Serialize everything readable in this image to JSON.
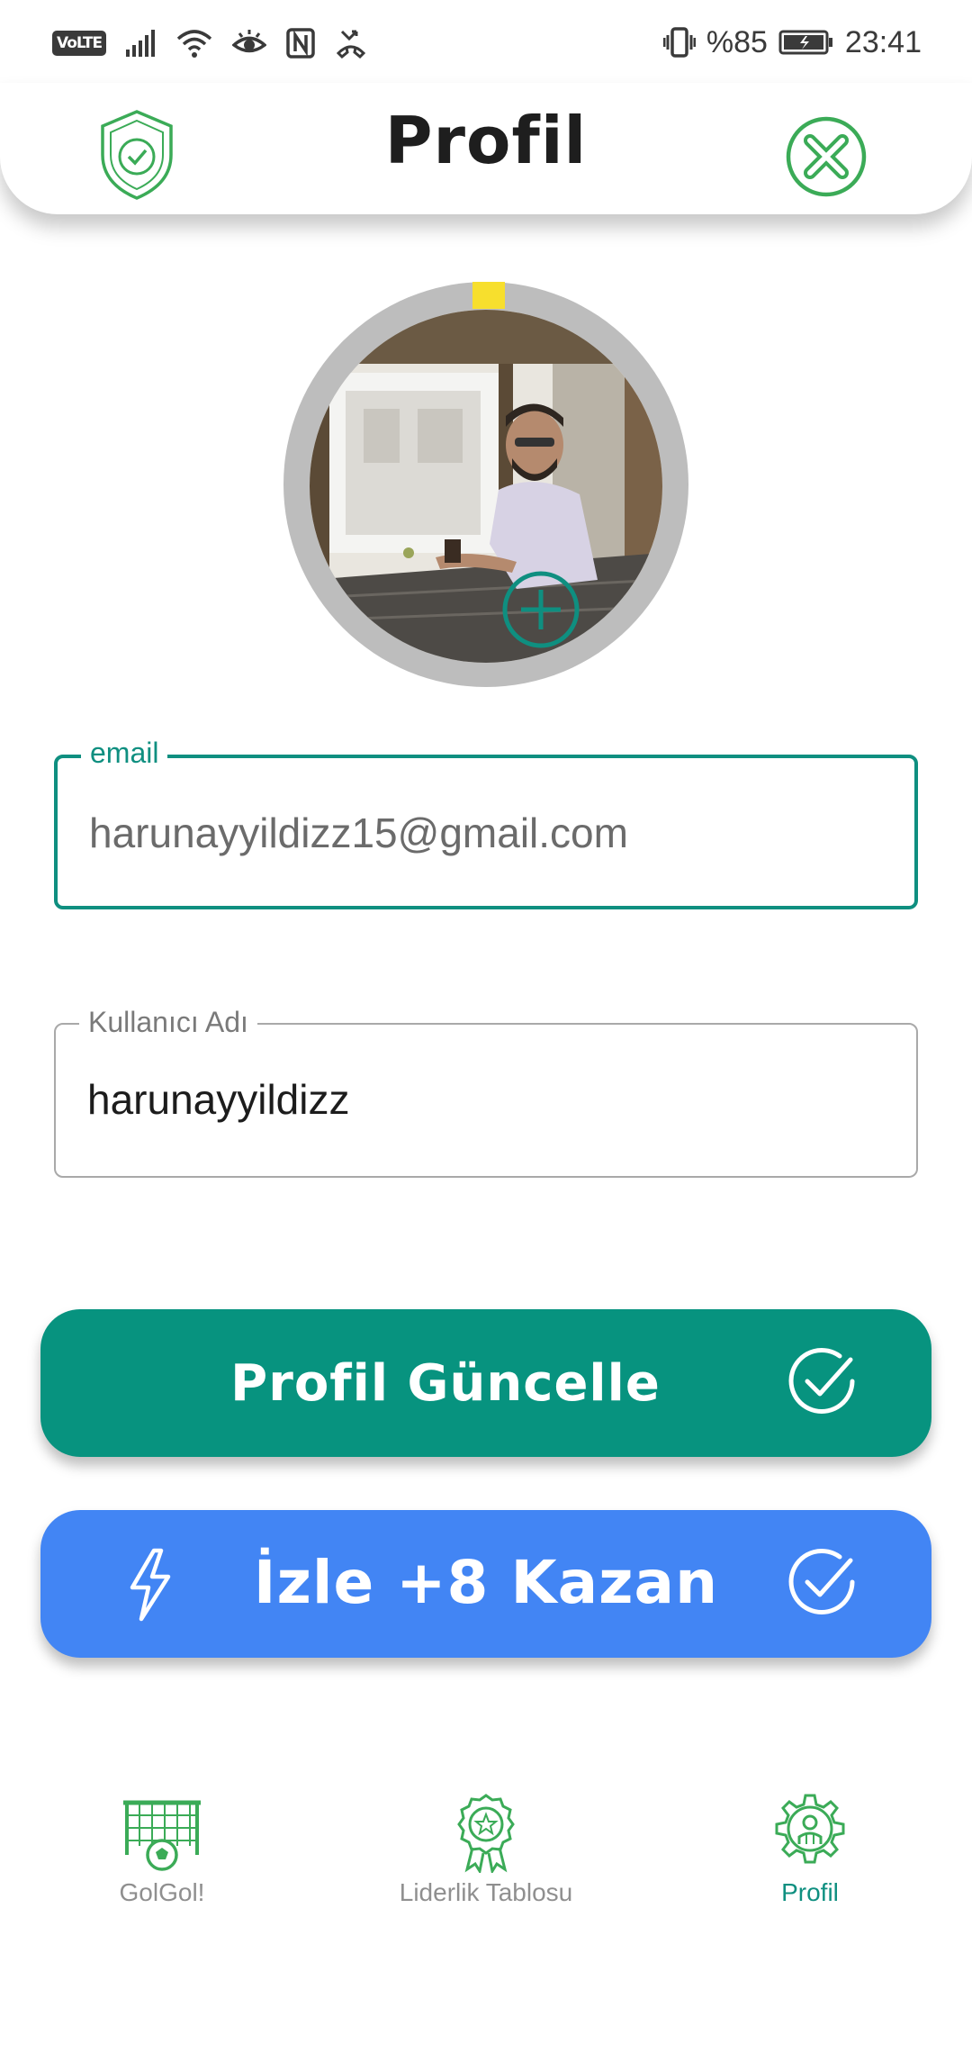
{
  "status_bar": {
    "volte": "VoLTE",
    "battery_percent": "%85",
    "time": "23:41"
  },
  "header": {
    "title": "Profil"
  },
  "avatar": {
    "progress_fraction": 0.03,
    "progress_color": "#f7df2d"
  },
  "form": {
    "email": {
      "label": "email",
      "value": "harunayyildizz15@gmail.com"
    },
    "username": {
      "label": "Kullanıcı Adı",
      "value": "harunayyildizz"
    }
  },
  "buttons": {
    "update_profile": "Profil Güncelle",
    "watch_earn": "İzle +8 Kazan"
  },
  "bottom_nav": {
    "items": [
      {
        "label": "GolGol!",
        "icon": "soccer-goal-icon",
        "active": false
      },
      {
        "label": "Liderlik Tablosu",
        "icon": "award-medal-icon",
        "active": false
      },
      {
        "label": "Profil",
        "icon": "user-gear-icon",
        "active": true
      }
    ]
  },
  "colors": {
    "teal": "#07937f",
    "blue": "#4285f4",
    "green_icon": "#3bab57"
  }
}
